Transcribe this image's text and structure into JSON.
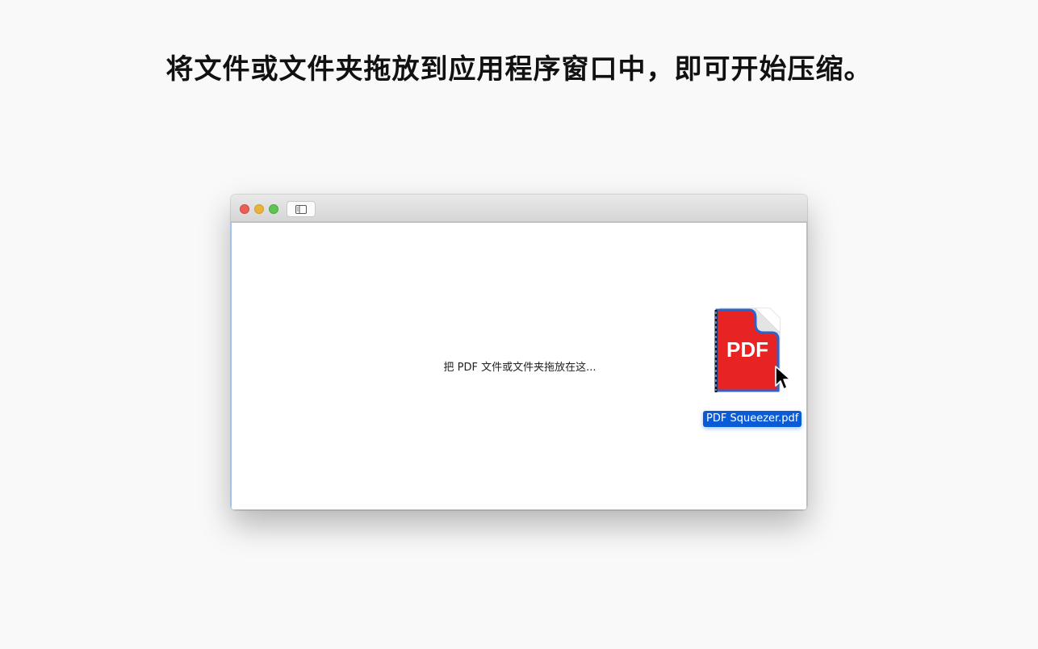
{
  "headline": "将文件或文件夹拖放到应用程序窗口中，即可开始压缩。",
  "window": {
    "controls": {
      "close": "close-button",
      "minimize": "minimize-button",
      "zoom": "zoom-button"
    },
    "toolbar": {
      "sidebar_toggle_icon": "sidebar-icon"
    },
    "drop_hint": "把 PDF 文件或文件夹拖放在这...",
    "dragged_file": {
      "icon_text": "PDF",
      "name": "PDF Squeezer.pdf",
      "icon": "pdf-file-icon"
    }
  },
  "colors": {
    "background": "#f9f9f9",
    "pdf_red": "#e82323",
    "selection_blue": "#0a5bd6",
    "close": "#ec5f57",
    "minimize": "#e9b43b",
    "zoom": "#5fc454"
  },
  "cursor": "arrow-cursor-icon"
}
